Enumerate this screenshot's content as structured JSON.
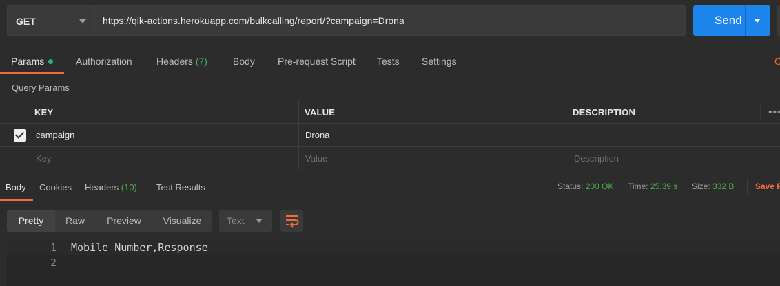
{
  "request": {
    "method": "GET",
    "url": "https://qik-actions.herokuapp.com/bulkcalling/report/?campaign=Drona",
    "send_label": "Send"
  },
  "request_tabs": {
    "params": "Params",
    "authorization": "Authorization",
    "headers": "Headers",
    "headers_count": "(7)",
    "body": "Body",
    "prerequest": "Pre-request Script",
    "tests": "Tests",
    "settings": "Settings",
    "cookies_partial": "C"
  },
  "query_params": {
    "title": "Query Params",
    "columns": {
      "key": "KEY",
      "value": "VALUE",
      "description": "DESCRIPTION"
    },
    "rows": [
      {
        "checked": true,
        "key": "campaign",
        "value": "Drona",
        "description": ""
      }
    ],
    "placeholders": {
      "key": "Key",
      "value": "Value",
      "description": "Description"
    }
  },
  "response": {
    "tabs": {
      "body": "Body",
      "cookies": "Cookies",
      "headers": "Headers",
      "headers_count": "(10)",
      "test_results": "Test Results"
    },
    "status_label": "Status:",
    "status_value": "200 OK",
    "time_label": "Time:",
    "time_value": "25.39 s",
    "size_label": "Size:",
    "size_value": "332 B",
    "save_partial": "Save R"
  },
  "format": {
    "pretty": "Pretty",
    "raw": "Raw",
    "preview": "Preview",
    "visualize": "Visualize",
    "type": "Text"
  },
  "code": {
    "lines": [
      {
        "num": "1",
        "text": "Mobile Number,Response"
      },
      {
        "num": "2",
        "text": ""
      }
    ]
  },
  "colors": {
    "accent": "#f26b3a",
    "send": "#1c84eb",
    "success": "#4caf50"
  }
}
